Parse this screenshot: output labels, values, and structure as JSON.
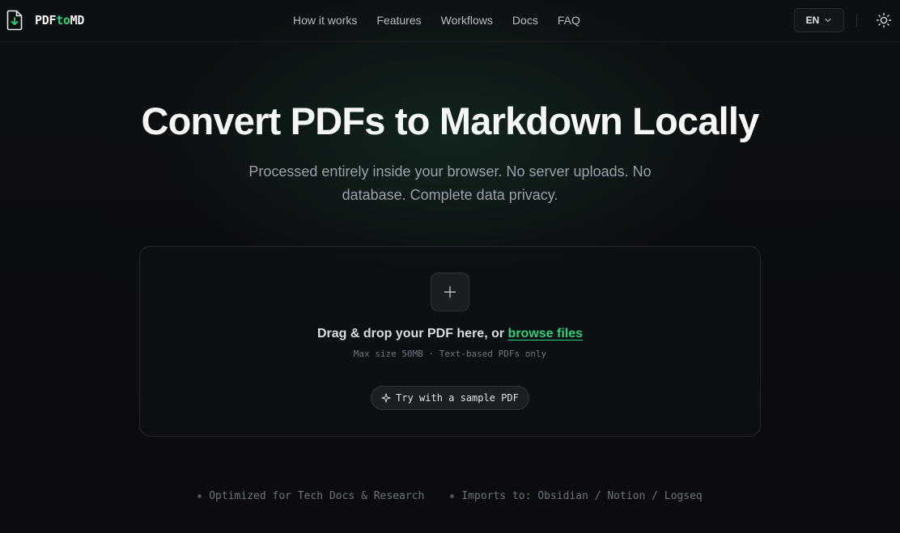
{
  "brand": {
    "prefix": "PDF",
    "accent": "to",
    "suffix": "MD",
    "accent_color": "#2ecf7f"
  },
  "nav": {
    "items": [
      {
        "label": "How it works"
      },
      {
        "label": "Features"
      },
      {
        "label": "Workflows"
      },
      {
        "label": "Docs"
      },
      {
        "label": "FAQ"
      }
    ]
  },
  "header": {
    "language": "EN",
    "language_icon": "chevron-down-icon",
    "theme_icon": "sun-icon"
  },
  "hero": {
    "title": "Convert PDFs to Markdown Locally",
    "subtitle": "Processed entirely inside your browser. No server uploads. No database. Complete data privacy."
  },
  "dropzone": {
    "add_icon": "plus-icon",
    "prompt": "Drag & drop your PDF here, or ",
    "browse_label": "browse files",
    "limits": "Max size 50MB · Text-based PDFs only",
    "sample_label": "Try with a sample PDF",
    "sample_icon": "sparkle-icon"
  },
  "features": [
    {
      "text": "Optimized for Tech Docs & Research"
    },
    {
      "text": "Imports to: Obsidian / Notion / Logseq"
    }
  ]
}
